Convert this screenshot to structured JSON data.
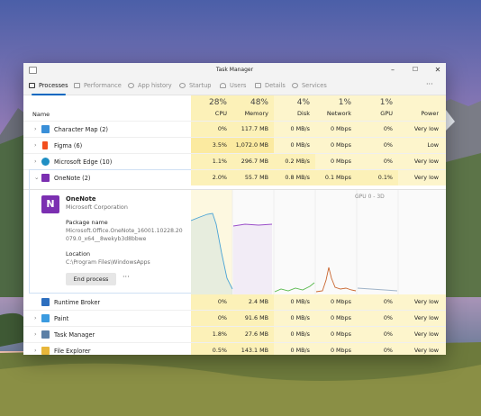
{
  "window": {
    "title": "Task Manager",
    "controls": {
      "minimize": "–",
      "maximize": "☐",
      "close": "✕"
    }
  },
  "tabs": [
    {
      "label": "Processes",
      "active": true
    },
    {
      "label": "Performance",
      "active": false
    },
    {
      "label": "App history",
      "active": false
    },
    {
      "label": "Startup",
      "active": false
    },
    {
      "label": "Users",
      "active": false
    },
    {
      "label": "Details",
      "active": false
    },
    {
      "label": "Services",
      "active": false
    }
  ],
  "more_label": "···",
  "columns": {
    "name": "Name",
    "cpu": {
      "pct": "28%",
      "label": "CPU"
    },
    "memory": {
      "pct": "48%",
      "label": "Memory"
    },
    "disk": {
      "pct": "4%",
      "label": "Disk"
    },
    "network": {
      "pct": "1%",
      "label": "Network"
    },
    "gpu": {
      "pct": "1%",
      "label": "GPU"
    },
    "power": {
      "label": "Power"
    }
  },
  "processes": [
    {
      "name": "Character Map (2)",
      "cpu": "0%",
      "memory": "117.7 MB",
      "disk": "0 MB/s",
      "network": "0 Mbps",
      "gpu": "0%",
      "power": "Very low",
      "icon_color": "#3a8fd8",
      "expanded": false
    },
    {
      "name": "Figma (6)",
      "cpu": "3.5%",
      "memory": "1,072.0 MB",
      "disk": "0 MB/s",
      "network": "0 Mbps",
      "gpu": "0%",
      "power": "Low",
      "icon_color": "#f24e1e",
      "expanded": false
    },
    {
      "name": "Microsoft Edge (10)",
      "cpu": "1.1%",
      "memory": "296.7 MB",
      "disk": "0.2 MB/s",
      "network": "0 Mbps",
      "gpu": "0%",
      "power": "Very low",
      "icon_color": "#1f8fc4",
      "expanded": false
    },
    {
      "name": "OneNote (2)",
      "cpu": "2.0%",
      "memory": "55.7 MB",
      "disk": "0.8 MB/s",
      "network": "0.1 Mbps",
      "gpu": "0.1%",
      "power": "Very low",
      "icon_color": "#7b2fb1",
      "expanded": true
    },
    {
      "name": "Runtime Broker",
      "cpu": "0%",
      "memory": "2.4 MB",
      "disk": "0 MB/s",
      "network": "0 Mbps",
      "gpu": "0%",
      "power": "Very low",
      "icon_color": "#2d6fbf",
      "expanded": false
    },
    {
      "name": "Paint",
      "cpu": "0%",
      "memory": "91.6 MB",
      "disk": "0 MB/s",
      "network": "0 Mbps",
      "gpu": "0%",
      "power": "Very low",
      "icon_color": "#3b9be0",
      "expanded": false
    },
    {
      "name": "Task Manager",
      "cpu": "1.8%",
      "memory": "27.6 MB",
      "disk": "0 MB/s",
      "network": "0 Mbps",
      "gpu": "0%",
      "power": "Very low",
      "icon_color": "#5b7fa6",
      "expanded": false
    },
    {
      "name": "File Explorer",
      "cpu": "0.5%",
      "memory": "143.1 MB",
      "disk": "0 MB/s",
      "network": "0 Mbps",
      "gpu": "0%",
      "power": "Very low",
      "icon_color": "#e8b63a",
      "expanded": false
    }
  ],
  "detail": {
    "app_name": "OneNote",
    "publisher": "Microsoft Corporation",
    "package_label": "Package name",
    "package_value": "Microsoft.Office.OneNote_16001.10228.20079.0_x64__8wekyb3d8bbwe",
    "location_label": "Location",
    "location_value": "C:\\Program Files\\WindowsApps",
    "end_button": "End process",
    "more": "···",
    "gpu_label": "GPU 0 - 3D",
    "logo_letter": "N"
  },
  "colors": {
    "accent": "#0067c0",
    "cpu_line": "#4aa3d6",
    "memory_line": "#9b4fc9",
    "disk_line": "#56b84a",
    "network_line": "#c9662f",
    "gpu_line": "#9fb3c8"
  }
}
